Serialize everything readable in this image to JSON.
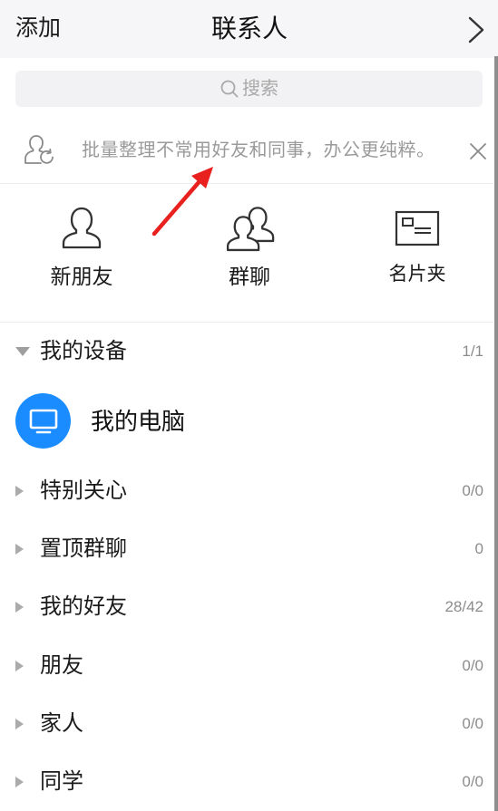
{
  "header": {
    "add_label": "添加",
    "title": "联系人",
    "forward_icon": "chevron-right-icon"
  },
  "search": {
    "placeholder": "搜索",
    "icon": "search-icon"
  },
  "notice": {
    "text": "批量整理不常用好友和同事，办公更纯粹。",
    "icon": "contact-refresh-icon",
    "close_icon": "close-icon"
  },
  "quick_actions": [
    {
      "label": "新朋友",
      "icon": "new-friend-icon"
    },
    {
      "label": "群聊",
      "icon": "group-chat-icon"
    },
    {
      "label": "名片夹",
      "icon": "business-card-icon"
    }
  ],
  "groups": [
    {
      "name": "我的设备",
      "count": "1/1",
      "expanded": true,
      "items": [
        {
          "name": "我的电脑",
          "icon": "monitor-icon"
        }
      ]
    },
    {
      "name": "特别关心",
      "count": "0/0",
      "expanded": false
    },
    {
      "name": "置顶群聊",
      "count": "0",
      "expanded": false
    },
    {
      "name": "我的好友",
      "count": "28/42",
      "expanded": false
    },
    {
      "name": "朋友",
      "count": "0/0",
      "expanded": false
    },
    {
      "name": "家人",
      "count": "0/0",
      "expanded": false
    },
    {
      "name": "同学",
      "count": "0/0",
      "expanded": false
    }
  ],
  "colors": {
    "header_bg": "#f6f6f8",
    "accent": "#1a8cff",
    "annotation": "#e8201e",
    "muted_text": "#9a9a9a"
  }
}
